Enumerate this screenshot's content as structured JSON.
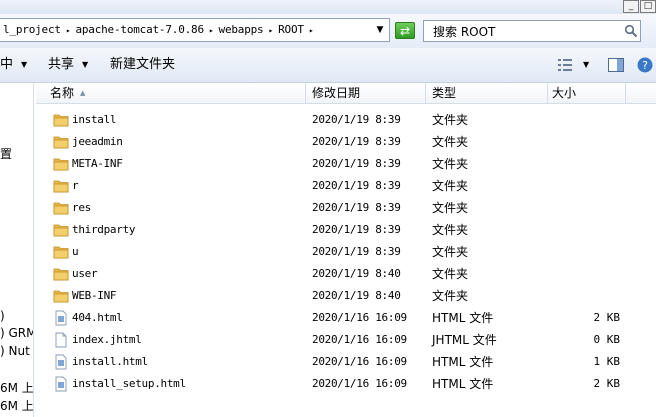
{
  "window": {
    "controls": [
      "_",
      "□"
    ]
  },
  "address": {
    "crumbs": [
      "l_project",
      "apache-tomcat-7.0.86",
      "webapps",
      "ROOT"
    ],
    "separator": "▸",
    "dropdown": "▼"
  },
  "search": {
    "value": "搜索 ROOT"
  },
  "toolbar": {
    "organize_partial": "中",
    "share_label": "共享",
    "new_folder_label": "新建文件夹",
    "arrow": "▼"
  },
  "nav_pane": {
    "fragments": [
      "置",
      ")",
      ") GRM",
      ") Nut",
      "6M 上",
      "6M 上"
    ]
  },
  "columns": {
    "name": "名称",
    "modified": "修改日期",
    "type": "类型",
    "size": "大小"
  },
  "files": [
    {
      "name": "install",
      "date": "2020/1/19 8:39",
      "type": "文件夹",
      "size": "",
      "icon": "folder-icon"
    },
    {
      "name": "jeeadmin",
      "date": "2020/1/19 8:39",
      "type": "文件夹",
      "size": "",
      "icon": "folder-icon"
    },
    {
      "name": "META-INF",
      "date": "2020/1/19 8:39",
      "type": "文件夹",
      "size": "",
      "icon": "folder-icon"
    },
    {
      "name": "r",
      "date": "2020/1/19 8:39",
      "type": "文件夹",
      "size": "",
      "icon": "folder-icon"
    },
    {
      "name": "res",
      "date": "2020/1/19 8:39",
      "type": "文件夹",
      "size": "",
      "icon": "folder-icon"
    },
    {
      "name": "thirdparty",
      "date": "2020/1/19 8:39",
      "type": "文件夹",
      "size": "",
      "icon": "folder-icon"
    },
    {
      "name": "u",
      "date": "2020/1/19 8:39",
      "type": "文件夹",
      "size": "",
      "icon": "folder-icon"
    },
    {
      "name": "user",
      "date": "2020/1/19 8:40",
      "type": "文件夹",
      "size": "",
      "icon": "folder-icon"
    },
    {
      "name": "WEB-INF",
      "date": "2020/1/19 8:40",
      "type": "文件夹",
      "size": "",
      "icon": "folder-icon"
    },
    {
      "name": "404.html",
      "date": "2020/1/16 16:09",
      "type": "HTML 文件",
      "size": "2 KB",
      "icon": "html-file-icon"
    },
    {
      "name": "index.jhtml",
      "date": "2020/1/16 16:09",
      "type": "JHTML 文件",
      "size": "0 KB",
      "icon": "blank-file-icon"
    },
    {
      "name": "install.html",
      "date": "2020/1/16 16:09",
      "type": "HTML 文件",
      "size": "1 KB",
      "icon": "html-file-icon"
    },
    {
      "name": "install_setup.html",
      "date": "2020/1/16 16:09",
      "type": "HTML 文件",
      "size": "2 KB",
      "icon": "html-file-icon"
    }
  ],
  "colors": {
    "folder": "#e8b84a",
    "chrome": "#dfe8f3",
    "refresh": "#2f9a24"
  }
}
